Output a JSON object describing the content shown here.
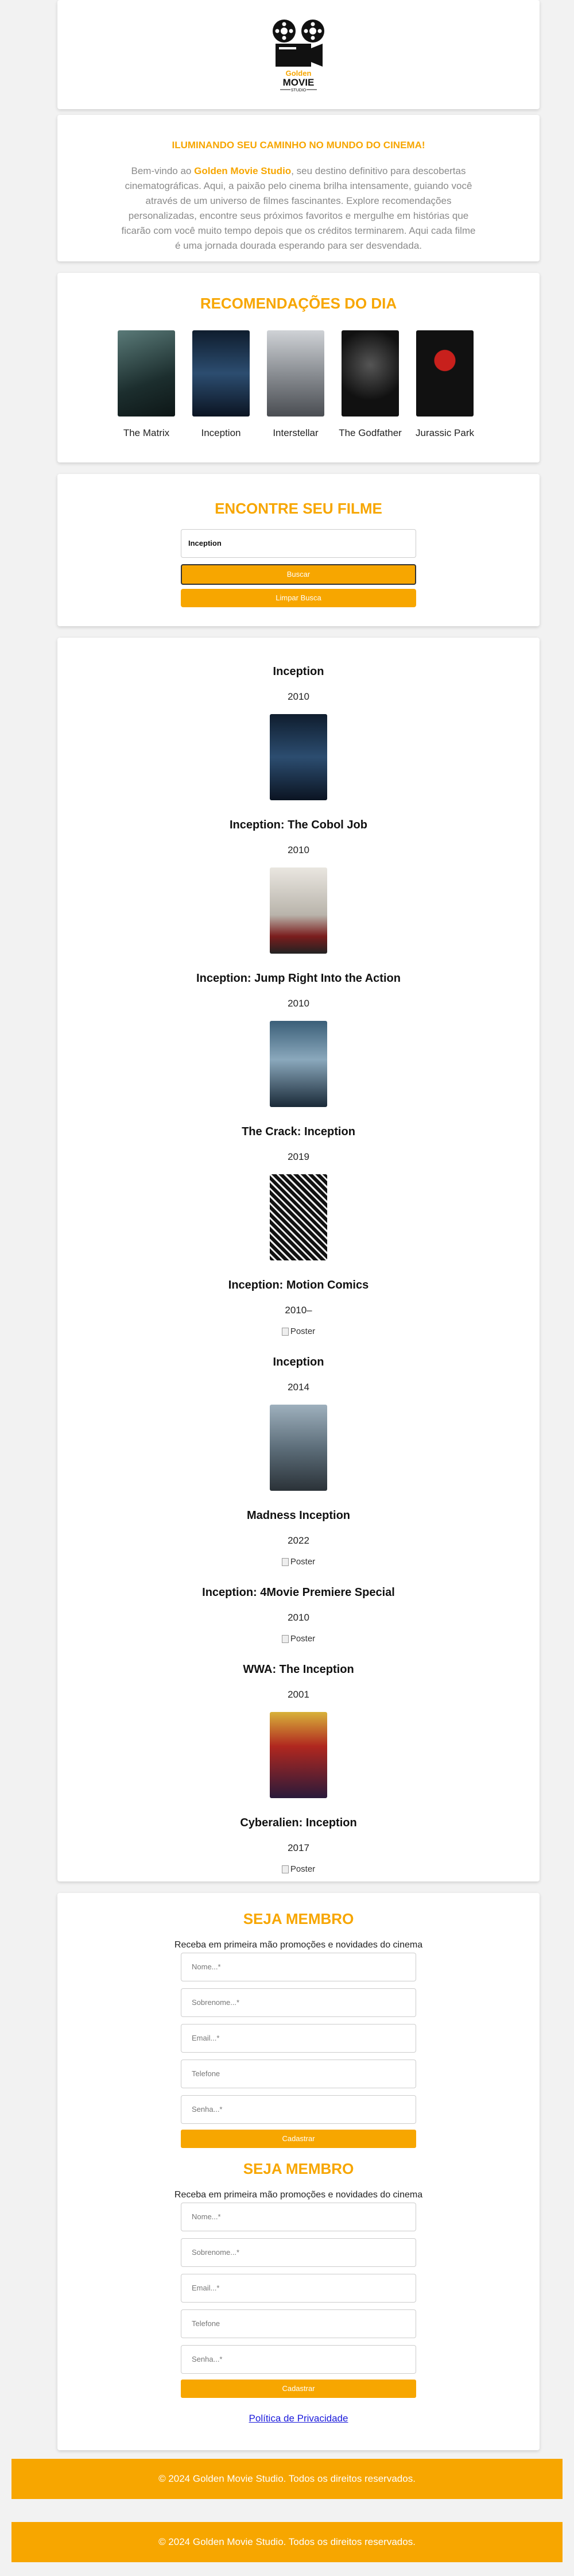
{
  "brand": {
    "line1": "Golden",
    "line2": "MOVIE",
    "line3": "STUDIO"
  },
  "welcome": {
    "heading": "ILUMINANDO SEU CAMINHO NO MUNDO DO CINEMA!",
    "text_before": "Bem-vindo ao ",
    "brand_name": "Golden Movie Studio",
    "text_after": ", seu destino definitivo para descobertas cinematográficas. Aqui, a paixão pelo cinema brilha intensamente, guiando você através de um universo de filmes fascinantes. Explore recomendações personalizadas, encontre seus próximos favoritos e mergulhe em histórias que ficarão com você muito tempo depois que os créditos terminarem. Aqui cada filme é uma jornada dourada esperando para ser desvendada."
  },
  "recommendations": {
    "heading": "RECOMENDAÇÕES DO DIA",
    "items": [
      {
        "label": "The Matrix",
        "color": "#2f4a4a"
      },
      {
        "label": "Inception",
        "color": "#1b3350"
      },
      {
        "label": "Interstellar",
        "color": "#8c8f94"
      },
      {
        "label": "The Godfather",
        "color": "#1a1a1a"
      },
      {
        "label": "Jurassic Park",
        "color": "#121212"
      }
    ]
  },
  "search": {
    "heading": "ENCONTRE SEU FILME",
    "value": "Inception",
    "search_label": "Buscar",
    "clear_label": "Limpar Busca"
  },
  "results": [
    {
      "title": "Inception",
      "year": "2010",
      "poster": true
    },
    {
      "title": "Inception: The Cobol Job",
      "year": "2010",
      "poster": true
    },
    {
      "title": "Inception: Jump Right Into the Action",
      "year": "2010",
      "poster": true
    },
    {
      "title": "The Crack: Inception",
      "year": "2019",
      "poster": true
    },
    {
      "title": "Inception: Motion Comics",
      "year": "2010–",
      "poster": false
    },
    {
      "title": "Inception",
      "year": "2014",
      "poster": true
    },
    {
      "title": "Madness Inception",
      "year": "2022",
      "poster": false
    },
    {
      "title": "Inception: 4Movie Premiere Special",
      "year": "2010",
      "poster": false
    },
    {
      "title": "WWA: The Inception",
      "year": "2001",
      "poster": true
    },
    {
      "title": "Cyberalien: Inception",
      "year": "2017",
      "poster": false
    }
  ],
  "broken_alt": "Poster",
  "member": {
    "heading": "SEJA MEMBRO",
    "subtitle": "Receba em primeira mão promoções e novidades do cinema",
    "fields": [
      "Nome...*",
      "Sobrenome...*",
      "Email...*",
      "Telefone",
      "Senha...*"
    ],
    "submit_label": "Cadastrar"
  },
  "privacy_label": "Política de Privacidade",
  "footer_text": "© 2024 Golden Movie Studio. Todos os direitos reservados.",
  "colors": {
    "accent": "#f7a600",
    "link": "#1a1adb"
  }
}
